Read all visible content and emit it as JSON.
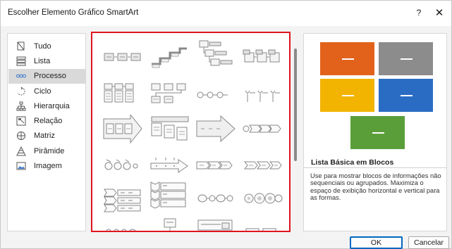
{
  "window": {
    "title": "Escolher Elemento Gráfico SmartArt",
    "help_glyph": "?",
    "close_glyph": "✕"
  },
  "categories": [
    {
      "label": "Tudo",
      "icon": "all-icon",
      "selected": false
    },
    {
      "label": "Lista",
      "icon": "list-icon",
      "selected": false
    },
    {
      "label": "Processo",
      "icon": "process-icon",
      "selected": true
    },
    {
      "label": "Ciclo",
      "icon": "cycle-icon",
      "selected": false
    },
    {
      "label": "Hierarquia",
      "icon": "hierarchy-icon",
      "selected": false
    },
    {
      "label": "Relação",
      "icon": "relationship-icon",
      "selected": false
    },
    {
      "label": "Matriz",
      "icon": "matrix-icon",
      "selected": false
    },
    {
      "label": "Pirâmide",
      "icon": "pyramid-icon",
      "selected": false
    },
    {
      "label": "Imagem",
      "icon": "picture-icon",
      "selected": false
    }
  ],
  "preview": {
    "title": "Lista Básica em Blocos",
    "description": "Use para mostrar blocos de informações não sequenciais ou agrupados. Maximiza o espaço de exibição horizontal e vertical para as formas.",
    "box_colors": [
      "#e2621b",
      "#8c8c8c",
      "#f2b400",
      "#2a6cc4",
      "#5a9e3a"
    ]
  },
  "buttons": {
    "ok": "OK",
    "cancel": "Cancelar"
  },
  "colors": {
    "highlight_border": "#e0141e",
    "selected_category": "#d9d9d9"
  }
}
